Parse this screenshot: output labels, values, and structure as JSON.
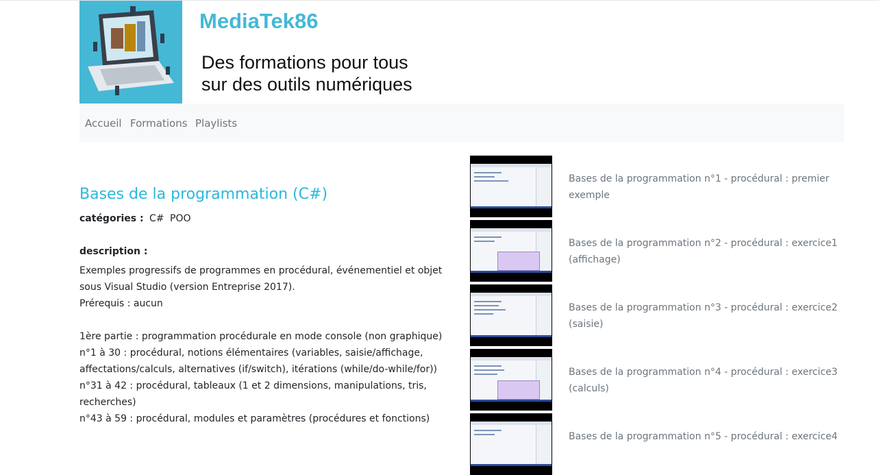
{
  "site": {
    "title": "MediaTek86",
    "tagline_line1": "Des formations pour tous",
    "tagline_line2": "sur des outils numériques"
  },
  "nav": {
    "items": [
      "Accueil",
      "Formations",
      "Playlists"
    ]
  },
  "formation": {
    "title": "Bases de la programmation (C#)",
    "categories_label": "catégories :",
    "categories": [
      "C#",
      "POO"
    ],
    "description_label": "description :",
    "description_lines": [
      "Exemples progressifs de programmes en procédural, événementiel et objet",
      "sous Visual Studio (version Entreprise 2017).",
      "Prérequis : aucun",
      "",
      "1ère partie : programmation procédurale en mode console (non graphique)",
      "n°1 à 30 : procédural, notions élémentaires (variables, saisie/affichage,",
      "affectations/calculs, alternatives (if/switch), itérations (while/do-while/for))",
      "n°31 à 42 : procédural, tableaux (1 et 2 dimensions, manipulations, tris,",
      "recherches)",
      "n°43 à 59 : procédural, modules et paramètres (procédures et fonctions)"
    ]
  },
  "videos": [
    {
      "title": "Bases de la programmation n°1 - procédural : premier exemple",
      "popup": false
    },
    {
      "title": "Bases de la programmation n°2 - procédural : exercice1 (affichage)",
      "popup": true
    },
    {
      "title": "Bases de la programmation n°3 - procédural : exercice2 (saisie)",
      "popup": false
    },
    {
      "title": "Bases de la programmation n°4 - procédural : exercice3 (calculs)",
      "popup": true
    },
    {
      "title": "Bases de la programmation n°5 - procédural : exercice4",
      "popup": false
    }
  ],
  "colors": {
    "brand": "#45b8d6",
    "title_accent": "#2bb8d9",
    "muted_text": "#6c757d",
    "navbar_bg": "#f8f9fa"
  }
}
